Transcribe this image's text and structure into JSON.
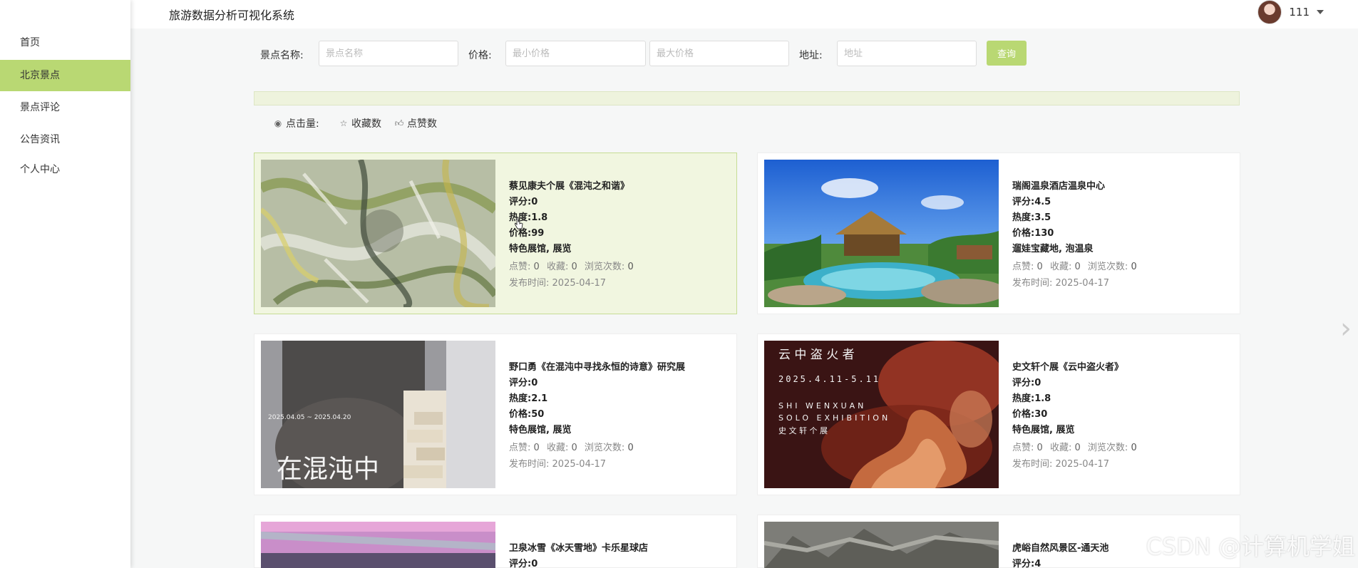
{
  "app": {
    "title": "旅游数据分析可视化系统"
  },
  "user": {
    "name": "111"
  },
  "sidebar": {
    "items": [
      {
        "label": "首页"
      },
      {
        "label": "北京景点"
      },
      {
        "label": "景点评论"
      },
      {
        "label": "公告资讯"
      },
      {
        "label": "个人中心"
      }
    ]
  },
  "search": {
    "name_label": "景点名称:",
    "name_placeholder": "景点名称",
    "price_label": "价格:",
    "min_placeholder": "最小价格",
    "max_placeholder": "最大价格",
    "address_label": "地址:",
    "address_placeholder": "地址",
    "query_label": "查询"
  },
  "sort": {
    "clicks": "点击量:",
    "favorites": "收藏数",
    "likes": "点赞数"
  },
  "labels": {
    "like": "点赞:",
    "fav": "收藏:",
    "views": "浏览次数:",
    "publish": "发布时间:"
  },
  "cards": [
    {
      "name": "蔡见康夫个展《混沌之和谐》",
      "rating": "评分:0",
      "heat": "热度:1.8",
      "price": "价格:99",
      "tags": "特色展馆, 展览",
      "likes": "0",
      "favs": "0",
      "views": "0",
      "date": "2025-04-17"
    },
    {
      "name": "瑞阁温泉酒店温泉中心",
      "rating": "评分:4.5",
      "heat": "热度:3.5",
      "price": "价格:130",
      "tags": "遛娃宝藏地, 泡温泉",
      "likes": "0",
      "favs": "0",
      "views": "0",
      "date": "2025-04-17"
    },
    {
      "name": "野口勇《在混沌中寻找永恒的诗意》研究展",
      "rating": "评分:0",
      "heat": "热度:2.1",
      "price": "价格:50",
      "tags": "特色展馆, 展览",
      "likes": "0",
      "favs": "0",
      "views": "0",
      "date": "2025-04-17"
    },
    {
      "name": "史文轩个展《云中盗火者》",
      "rating": "评分:0",
      "heat": "热度:1.8",
      "price": "价格:30",
      "tags": "特色展馆, 展览",
      "likes": "0",
      "favs": "0",
      "views": "0",
      "date": "2025-04-17"
    },
    {
      "name": "卫泉冰雪《冰天雪地》卡乐星球店",
      "rating": "评分:0"
    },
    {
      "name": "虎峪自然风景区-通天池",
      "rating": "评分:4"
    }
  ],
  "images": {
    "poster3_dates": "2025.04.05 ~ 2025.04.20",
    "poster3_big": "在混沌中",
    "poster4_title": "云 中   盗 火 者",
    "poster4_dates": "2025.4.11-5.11",
    "poster4_en1": "SHI WENXUAN",
    "poster4_en2": "SOLO EXHIBITION",
    "poster4_cn": "史 文 轩   个 展"
  },
  "watermark": "CSDN @计算机学姐",
  "colors": {
    "accent": "#b9d873",
    "highlight": "#f1f6e0"
  }
}
